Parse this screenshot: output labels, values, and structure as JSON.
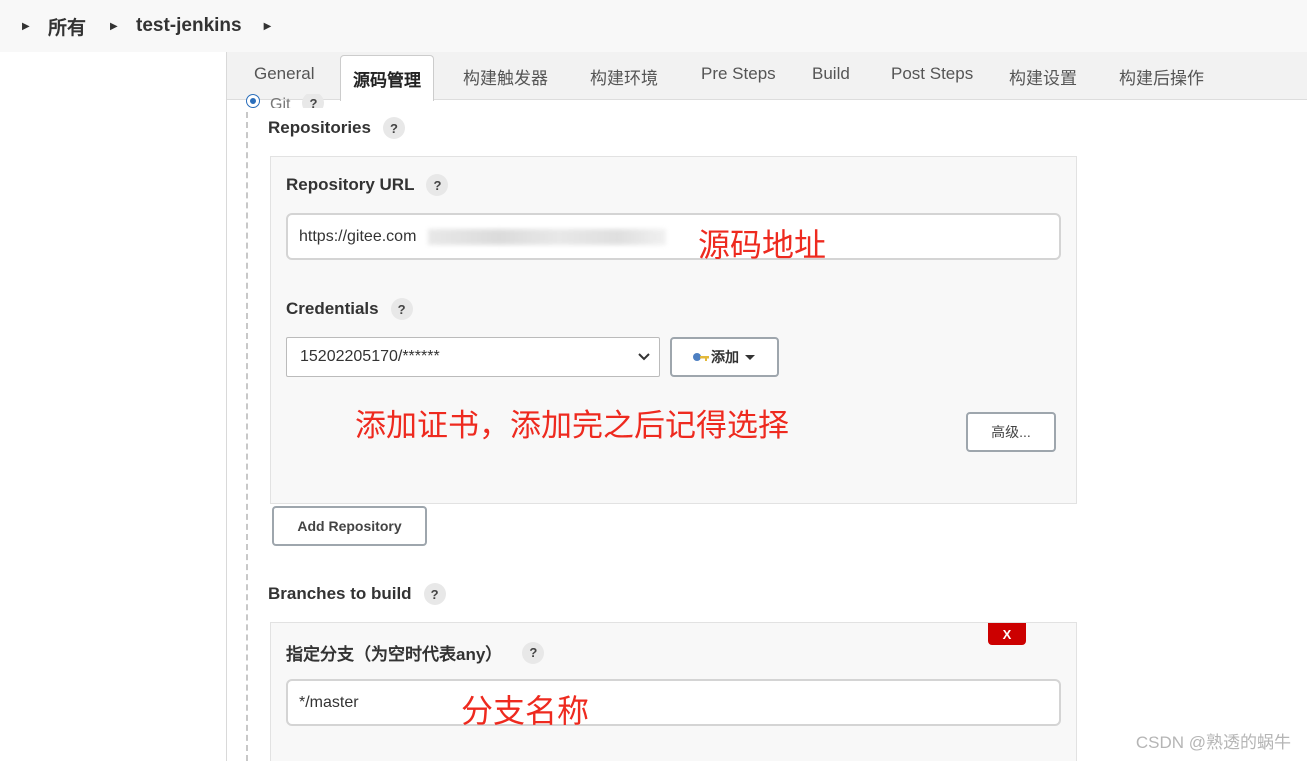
{
  "breadcrumb": {
    "items": [
      "所有",
      "test-jenkins"
    ]
  },
  "tabs": [
    {
      "label": "General"
    },
    {
      "label": "源码管理"
    },
    {
      "label": "构建触发器"
    },
    {
      "label": "构建环境"
    },
    {
      "label": "Pre Steps"
    },
    {
      "label": "Build"
    },
    {
      "label": "Post Steps"
    },
    {
      "label": "构建设置"
    },
    {
      "label": "构建后操作"
    }
  ],
  "scm": {
    "git_label": "Git",
    "help": "?",
    "repositories_label": "Repositories",
    "repo_url_label": "Repository URL",
    "repo_url_value": "https://gitee.com",
    "credentials_label": "Credentials",
    "credentials_value": "15202205170/******",
    "add_button_label": "添加",
    "advanced_button_label": "高级...",
    "add_repository_label": "Add Repository",
    "branches_label": "Branches to build",
    "delete_label": "X",
    "branch_spec_label": "指定分支（为空时代表any）",
    "branch_value": "*/master"
  },
  "annotations": {
    "repo_url_note": "源码地址",
    "credentials_note": "添加证书，添加完之后记得选择",
    "branch_note": "分支名称"
  },
  "watermark": "CSDN @熟透的蜗牛",
  "colors": {
    "annotation": "#ee2a1f",
    "delete": "#cc0000",
    "radio": "#2a6ebb"
  }
}
